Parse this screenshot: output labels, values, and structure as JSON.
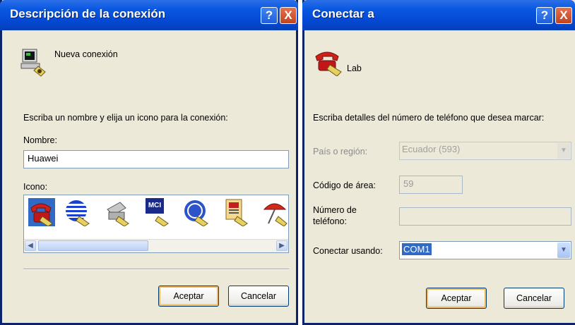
{
  "dialog1": {
    "title": "Descripción de la conexión",
    "help": "?",
    "close": "X",
    "connection_label": "Nueva conexión",
    "instruction": "Escriba un nombre y elija un icono para la conexión:",
    "name_label": "Nombre:",
    "name_value": "Huawei",
    "icon_label": "Icono:",
    "icons": [
      "phone-icon",
      "globe-icon",
      "fax-icon",
      "mci-icon",
      "ge-icon",
      "documents-icon",
      "umbrella-icon"
    ],
    "mci_text": "MCI",
    "ok": "Aceptar",
    "cancel": "Cancelar"
  },
  "dialog2": {
    "title": "Conectar a",
    "help": "?",
    "close": "X",
    "connection_name": "Lab",
    "instruction": "Escriba detalles del número de teléfono que desea marcar:",
    "country_label": "País o región:",
    "country_value": "Ecuador (593)",
    "area_label": "Código de área:",
    "area_value": "59",
    "phone_label_1": "Número de",
    "phone_label_2": "teléfono:",
    "phone_value": "",
    "connect_using_label": "Conectar usando:",
    "connect_using_value": "COM1",
    "ok": "Aceptar",
    "cancel": "Cancelar"
  }
}
